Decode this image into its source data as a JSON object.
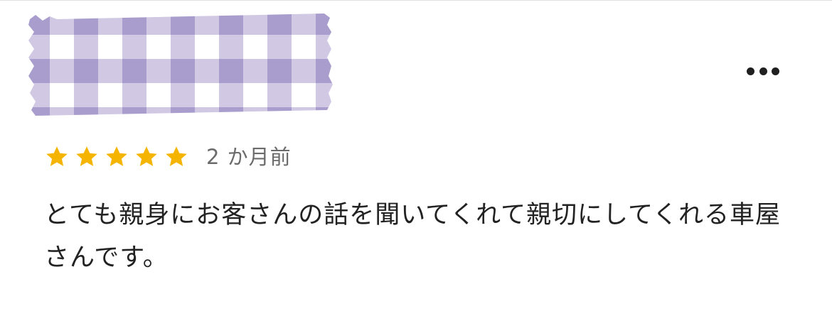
{
  "review": {
    "rating": 5,
    "max_rating": 5,
    "time_ago": "2 か月前",
    "text": "とても親身にお客さんの話を聞いてくれて親切にしてくれる車屋さんです。"
  },
  "icons": {
    "star": "star-icon",
    "more": "more-options-icon",
    "avatar": "gingham-tape-image"
  },
  "colors": {
    "star": "#f4b400",
    "tape_light": "#c9c0e0",
    "tape_dark": "#a99dcd",
    "text": "#222222",
    "meta": "#6b6b6b"
  }
}
